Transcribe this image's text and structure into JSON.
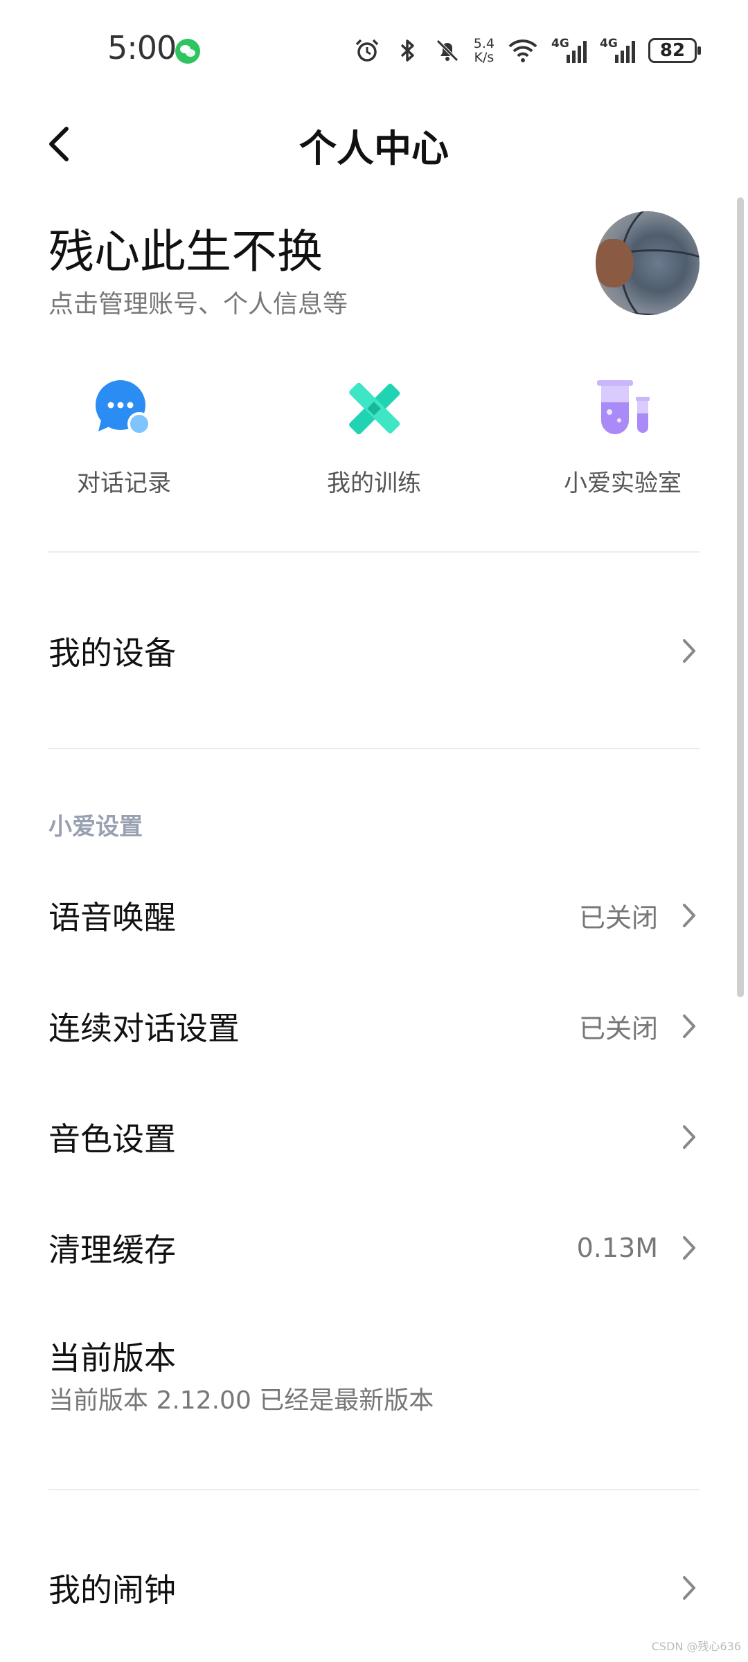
{
  "status_bar": {
    "time": "5:00",
    "net_speed_value": "5.4",
    "net_speed_unit": "K/s",
    "sim1_tag": "4G",
    "sim2_tag": "4G",
    "battery_level": "82"
  },
  "header": {
    "title": "个人中心"
  },
  "profile": {
    "username": "残心此生不换",
    "subtitle": "点击管理账号、个人信息等"
  },
  "quick_actions": [
    {
      "label": "对话记录",
      "icon": "chat-bubble-icon",
      "color": "#2b8cf3"
    },
    {
      "label": "我的训练",
      "icon": "training-cross-icon",
      "color": "#1fd3b3"
    },
    {
      "label": "小爱实验室",
      "icon": "lab-tubes-icon",
      "color": "#a98af7"
    }
  ],
  "devices": {
    "label": "我的设备"
  },
  "xiaoai_settings": {
    "section_title": "小爱设置",
    "voice_wakeup": {
      "label": "语音唤醒",
      "value": "已关闭"
    },
    "continuous_dialog": {
      "label": "连续对话设置",
      "value": "已关闭"
    },
    "timbre": {
      "label": "音色设置"
    },
    "clear_cache": {
      "label": "清理缓存",
      "value": "0.13M"
    },
    "version": {
      "label": "当前版本",
      "detail": "当前版本 2.12.00 已经是最新版本"
    }
  },
  "alarm": {
    "label": "我的闹钟"
  },
  "watermark": "CSDN @残心636"
}
